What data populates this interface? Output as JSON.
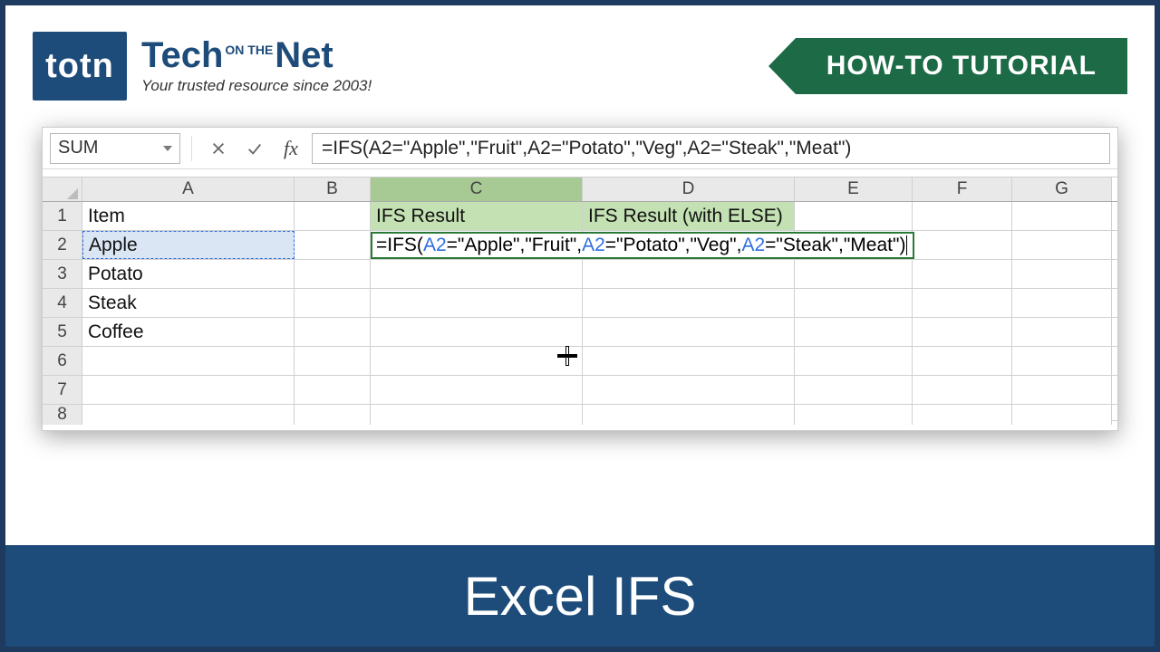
{
  "brand": {
    "short": "totn",
    "line1_a": "Tech",
    "line1_small": "ON THE",
    "line1_b": "Net",
    "tagline": "Your trusted resource since 2003!"
  },
  "ribbon": {
    "label": "HOW-TO TUTORIAL"
  },
  "formula_bar": {
    "name_box": "SUM",
    "formula_plain": "=IFS(A2=\"Apple\",\"Fruit\",A2=\"Potato\",\"Veg\",A2=\"Steak\",\"Meat\")"
  },
  "columns": [
    "A",
    "B",
    "C",
    "D",
    "E",
    "F",
    "G"
  ],
  "row_numbers": [
    "1",
    "2",
    "3",
    "4",
    "5",
    "6",
    "7",
    "8"
  ],
  "cells": {
    "A1": "Item",
    "C1": "IFS Result",
    "D1": "IFS Result (with ELSE)",
    "A2": "Apple",
    "A3": "Potato",
    "A4": "Steak",
    "A5": "Coffee"
  },
  "editing": {
    "p1": "=IFS(",
    "r1": "A2",
    "p2": "=\"Apple\",\"Fruit\",",
    "r2": "A2",
    "p3": "=\"Potato\",\"Veg\",",
    "r3": "A2",
    "p4": "=\"Steak\",\"Meat\")"
  },
  "footer": {
    "title": "Excel IFS"
  }
}
